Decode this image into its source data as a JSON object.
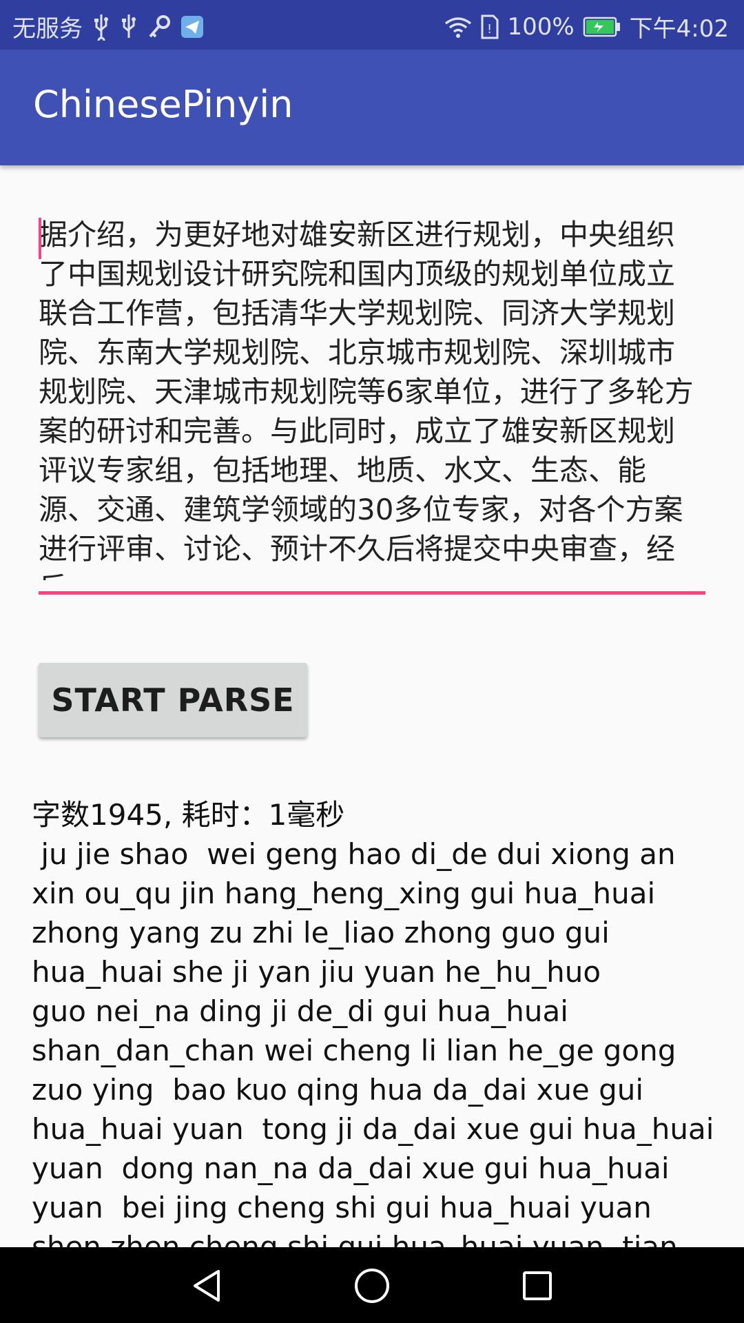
{
  "status_bar": {
    "carrier": "无服务",
    "battery_percent": "100%",
    "time": "下午4:02",
    "icons": [
      "usb-icon",
      "usb-icon",
      "key-icon",
      "telegram-icon",
      "wifi-icon",
      "sim-icon",
      "battery-charging-icon"
    ]
  },
  "app_bar": {
    "title": "ChinesePinyin"
  },
  "input": {
    "value": "据介绍，为更好地对雄安新区进行规划，中央组织了中国规划设计研究院和国内顶级的规划单位成立联合工作营，包括清华大学规划院、同济大学规划院、东南大学规划院、北京城市规划院、深圳城市规划院、天津城市规划院等6家单位，进行了多轮方案的研讨和完善。与此同时，成立了雄安新区规划评议专家组，包括地理、地质、水文、生态、能源、交通、建筑学领域的30多位专家，对各个方案进行评审、讨论、预计不久后将提交中央审查，经反"
  },
  "parse_button": {
    "label": "START PARSE"
  },
  "result": {
    "lines": [
      "字数1945, 耗时：1毫秒",
      " ju jie shao  wei geng hao di_de dui xiong an",
      "xin ou_qu jin hang_heng_xing gui hua_huai",
      "zhong yang zu zhi le_liao zhong guo gui",
      "hua_huai she ji yan jiu yuan he_hu_huo",
      "guo nei_na ding ji de_di gui hua_huai",
      "shan_dan_chan wei cheng li lian he_ge gong",
      "zuo ying  bao kuo qing hua da_dai xue gui",
      "hua_huai yuan  tong ji da_dai xue gui hua_huai",
      "yuan  dong nan_na da_dai xue gui hua_huai",
      "yuan  bei jing cheng shi gui hua_huai yuan",
      "shen zhen cheng shi gui hua_huai yuan  tian"
    ]
  },
  "colors": {
    "status_bar": "#303f9f",
    "app_bar": "#3f51b5",
    "accent": "#ff4081",
    "button": "#d6d7d7"
  },
  "nav_bar": {
    "icons": [
      "back-icon",
      "home-icon",
      "recents-icon"
    ]
  }
}
